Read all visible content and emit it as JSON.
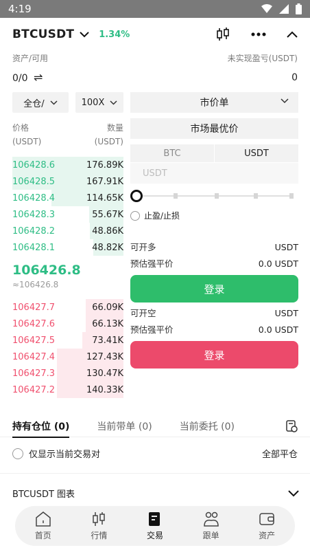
{
  "status": {
    "time": "4:19"
  },
  "header": {
    "pair": "BTCUSDT",
    "change": "1.34%"
  },
  "assets": {
    "left_label": "资产/可用",
    "right_label": "未实现盈亏(USDT)",
    "left_value": "0/0",
    "right_value": "0"
  },
  "left_panel": {
    "margin_mode": "全仓/",
    "leverage": "100X",
    "price_header": [
      "价格",
      "(USDT)"
    ],
    "qty_header": [
      "数量",
      "(USDT)"
    ],
    "bids": [
      {
        "price": "106428.6",
        "qty": "176.89K",
        "depth": 1.0
      },
      {
        "price": "106428.5",
        "qty": "167.91K",
        "depth": 1.0
      },
      {
        "price": "106428.4",
        "qty": "114.65K",
        "depth": 0.65
      },
      {
        "price": "106428.3",
        "qty": "55.67K",
        "depth": 0.31
      },
      {
        "price": "106428.2",
        "qty": "48.86K",
        "depth": 0.3
      },
      {
        "price": "106428.1",
        "qty": "48.82K",
        "depth": 0.27
      }
    ],
    "mid_price": "106426.8",
    "mid_sub": "≈106426.8",
    "asks": [
      {
        "price": "106427.7",
        "qty": "66.09K",
        "depth": 0.34
      },
      {
        "price": "106427.6",
        "qty": "66.13K",
        "depth": 0.34
      },
      {
        "price": "106427.5",
        "qty": "73.41K",
        "depth": 0.37
      },
      {
        "price": "106427.4",
        "qty": "127.43K",
        "depth": 0.6
      },
      {
        "price": "106427.3",
        "qty": "130.47K",
        "depth": 0.6
      },
      {
        "price": "106427.2",
        "qty": "140.33K",
        "depth": 0.6
      }
    ]
  },
  "right_panel": {
    "order_type": "市价单",
    "market_price": "市场最优价",
    "unit_tab_1": "BTC",
    "unit_tab_2": "USDT",
    "amount_placeholder": "USDT",
    "tpsl_label": "止盈/止损",
    "long": {
      "avail_label": "可开多",
      "avail_value": "USDT",
      "liq_label": "预估强平价",
      "liq_value": "0.0 USDT",
      "button": "登录"
    },
    "short": {
      "avail_label": "可开空",
      "avail_value": "USDT",
      "liq_label": "预估强平价",
      "liq_value": "0.0 USDT",
      "button": "登录"
    }
  },
  "tabs": {
    "positions": "持有仓位 (0)",
    "copy_orders": "当前带单 (0)",
    "open_orders": "当前委托 (0)"
  },
  "filter": {
    "only_current": "仅显示当前交易对",
    "close_all": "全部平仓"
  },
  "chart": {
    "label": "BTCUSDT  图表"
  },
  "nav": {
    "home": "首页",
    "market": "行情",
    "trade": "交易",
    "copy": "跟单",
    "assets": "资产"
  },
  "colors": {
    "buy": "#2ebd85",
    "sell": "#f0506e",
    "long_button": "#2ebd6b",
    "short_button": "#ec4a6b"
  }
}
